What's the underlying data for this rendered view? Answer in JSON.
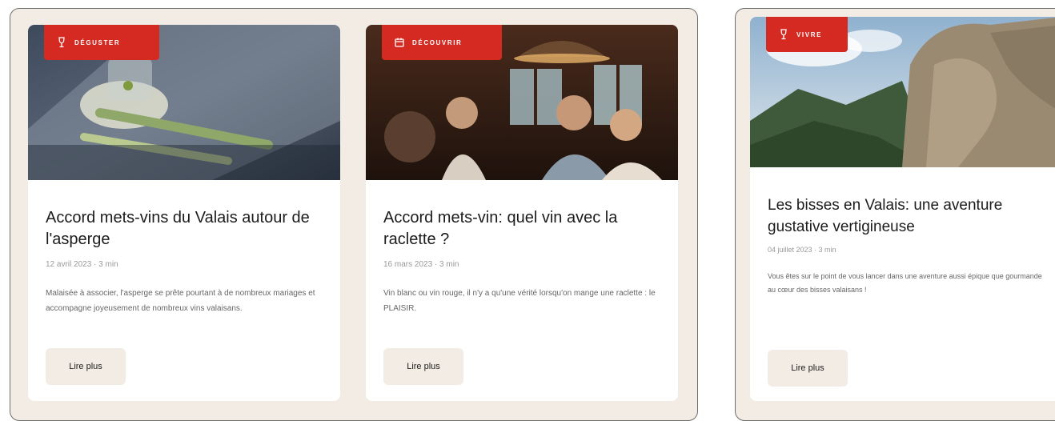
{
  "cards": [
    {
      "tag": "DÉGUSTER",
      "title": "Accord mets-vins du Valais autour de l'asperge",
      "meta": "12 avril 2023 · 3 min",
      "description": "Malaisée à associer, l'asperge se prête pourtant à de nombreux mariages et accompagne joyeusement de nombreux vins valaisans.",
      "button": "Lire plus",
      "tag_icon": "wine-glass-icon"
    },
    {
      "tag": "DÉCOUVRIR",
      "title": "Accord mets-vin: quel vin avec la raclette ?",
      "meta": "16 mars 2023 · 3 min",
      "description": "Vin blanc ou vin rouge, il n'y a qu'une vérité lorsqu'on mange une raclette : le PLAISIR.",
      "button": "Lire plus",
      "tag_icon": "calendar-icon"
    },
    {
      "tag": "VIVRE",
      "title": "Les bisses en Valais: une aventure gustative vertigineuse",
      "meta": "04 juillet 2023 · 3 min",
      "description": "Vous êtes sur le point de vous lancer dans une aventure aussi épique que gourmande au cœur des bisses valaisans !",
      "button": "Lire plus",
      "tag_icon": "wine-glass-icon"
    }
  ],
  "colors": {
    "tag_red": "#d42a22",
    "panel_bg": "#f3ece4",
    "card_bg": "#ffffff",
    "title": "#1c1c1c"
  }
}
